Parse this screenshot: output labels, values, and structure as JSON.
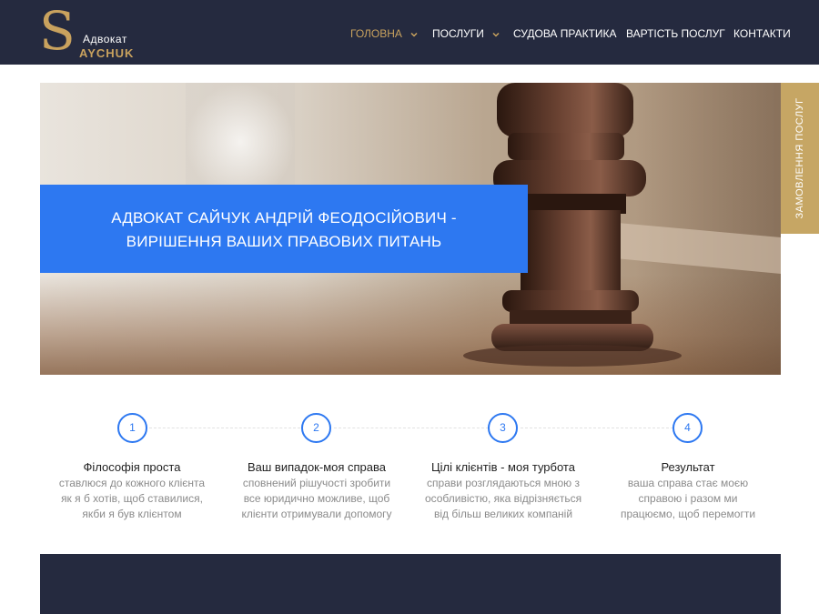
{
  "brand": {
    "logo_letter": "S",
    "logo_top": "Адвокат",
    "logo_bottom": "AYCHUK"
  },
  "nav": {
    "items": [
      {
        "label": "ГОЛОВНА",
        "active": true,
        "has_dropdown": true
      },
      {
        "label": "ПОСЛУГИ",
        "active": false,
        "has_dropdown": true
      },
      {
        "label": "СУДОВА ПРАКТИКА",
        "active": false,
        "has_dropdown": false
      },
      {
        "label": "ВАРТІСТЬ ПОСЛУГ",
        "active": false,
        "has_dropdown": false
      },
      {
        "label": "КОНТАКТИ",
        "active": false,
        "has_dropdown": false
      }
    ]
  },
  "hero": {
    "title_line1": "АДВОКАТ САЙЧУК АНДРІЙ ФЕОДОСІЙОВИЧ -",
    "title_line2": "ВИРІШЕННЯ ВАШИХ ПРАВОВИХ ПИТАНЬ",
    "image": "gavel-image"
  },
  "side_tab": {
    "label": "ЗАМОВЛЕННЯ ПОСЛУГ"
  },
  "steps": [
    {
      "number": "1",
      "title": "Філософія проста",
      "desc": [
        "ставлюся до кожного клієнта",
        "як я б хотів, щоб ставилися,",
        "якби я був клієнтом"
      ]
    },
    {
      "number": "2",
      "title": "Ваш випадок-моя справа",
      "desc": [
        "сповнений рішучості зробити",
        "все юридично можливе, щоб",
        "клієнти отримували допомогу"
      ]
    },
    {
      "number": "3",
      "title": "Цілі клієнтів - моя турбота",
      "desc": [
        "справи розглядаються мною з",
        "особливістю, яка відрізняється",
        "від більш великих компаній"
      ]
    },
    {
      "number": "4",
      "title": "Результат",
      "desc": [
        "ваша справа стає моєю",
        "справою  і разом ми",
        "працюємо, щоб перемогти"
      ]
    }
  ],
  "colors": {
    "header_bg": "#252a3f",
    "accent_gold": "#c9a25e",
    "accent_blue": "#2d78f1"
  }
}
